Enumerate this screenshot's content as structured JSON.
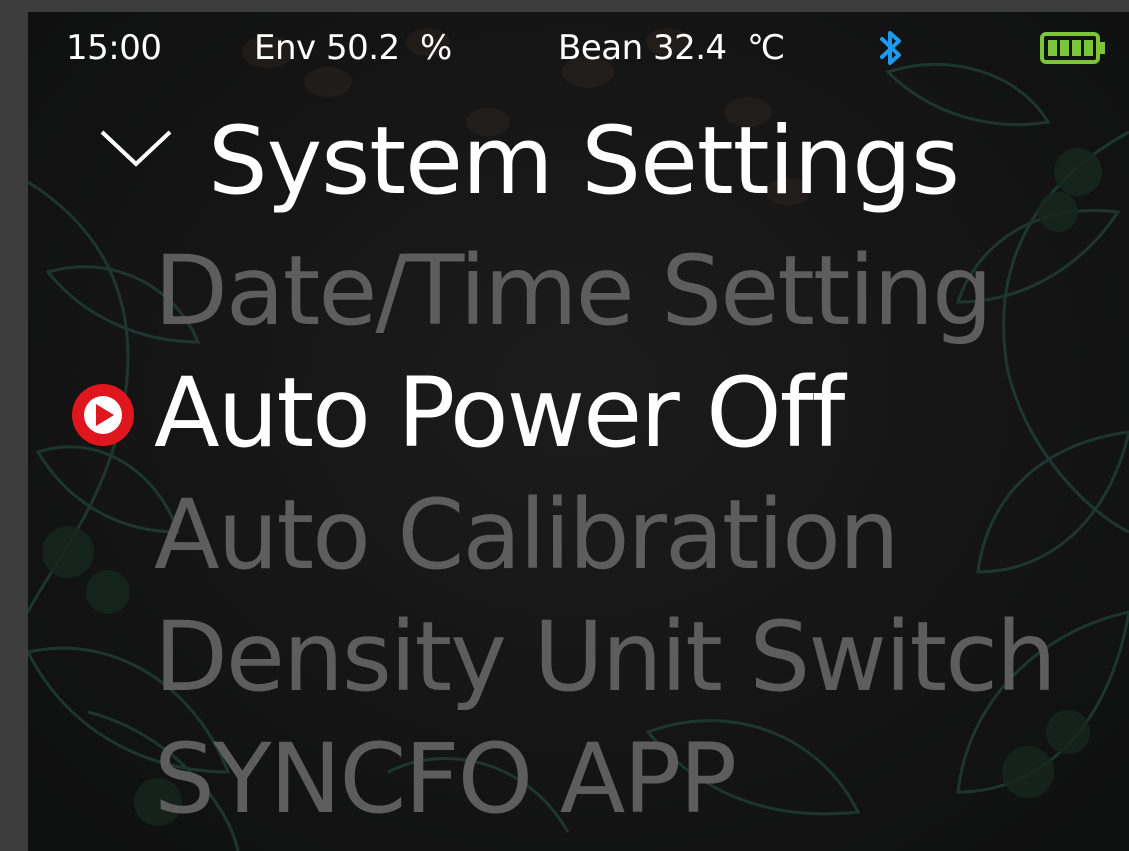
{
  "status_bar": {
    "time": "15:00",
    "env_label": "Env",
    "env_value": "50.2",
    "env_unit": "%",
    "bean_label": "Bean",
    "bean_value": "32.4",
    "bean_unit": "℃",
    "bluetooth_icon": "bluetooth-icon",
    "battery_icon": "battery-full-icon"
  },
  "header": {
    "title": "System Settings",
    "collapse_icon": "chevron-down-icon"
  },
  "menu": {
    "selected_index": 1,
    "selector_icon": "play-circle-icon",
    "items": [
      {
        "label": "Date/Time Setting"
      },
      {
        "label": "Auto Power Off"
      },
      {
        "label": "Auto Calibration"
      },
      {
        "label": "Density Unit Switch"
      },
      {
        "label": "SYNCFO APP"
      }
    ]
  },
  "colors": {
    "background": "#141414",
    "text_active": "#ffffff",
    "text_inactive": "#5d5d5d",
    "accent_selector": "#e0161f",
    "bluetooth": "#1e9bf0",
    "battery": "#7cc43a",
    "foliage": "#1e3a32"
  }
}
